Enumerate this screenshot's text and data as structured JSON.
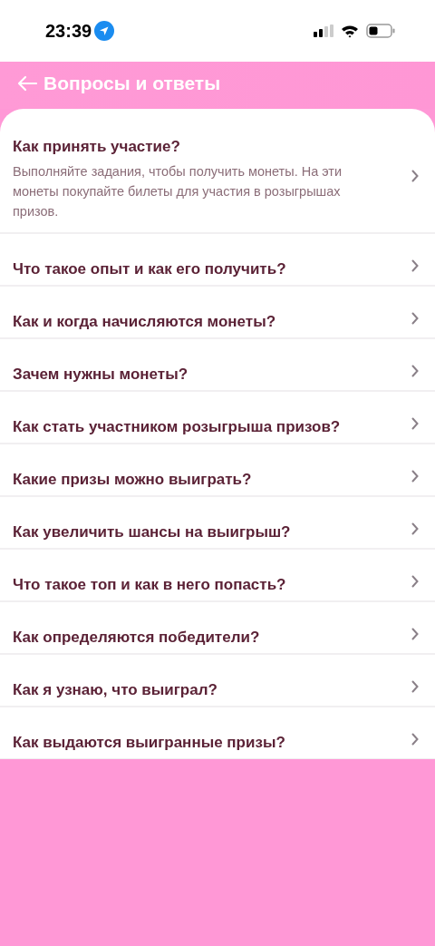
{
  "status_bar": {
    "time": "23:39"
  },
  "header": {
    "title": "Вопросы и ответы"
  },
  "faq": [
    {
      "question": "Как принять участие?",
      "answer": "Выполняйте задания, чтобы получить монеты. На эти монеты покупайте билеты для участия в розыгрышах призов.",
      "expanded": true
    },
    {
      "question": "Что такое опыт и как его получить?",
      "expanded": false
    },
    {
      "question": "Как и когда начисляются монеты?",
      "expanded": false
    },
    {
      "question": "Зачем нужны монеты?",
      "expanded": false
    },
    {
      "question": "Как стать участником розыгрыша призов?",
      "expanded": false
    },
    {
      "question": "Какие призы можно выиграть?",
      "expanded": false
    },
    {
      "question": "Как увеличить шансы на выигрыш?",
      "expanded": false
    },
    {
      "question": "Что такое топ и как в него попасть?",
      "expanded": false
    },
    {
      "question": "Как определяются победители?",
      "expanded": false
    },
    {
      "question": "Как я узнаю, что выиграл?",
      "expanded": false
    },
    {
      "question": "Как выдаются выигранные призы?",
      "expanded": false
    }
  ]
}
